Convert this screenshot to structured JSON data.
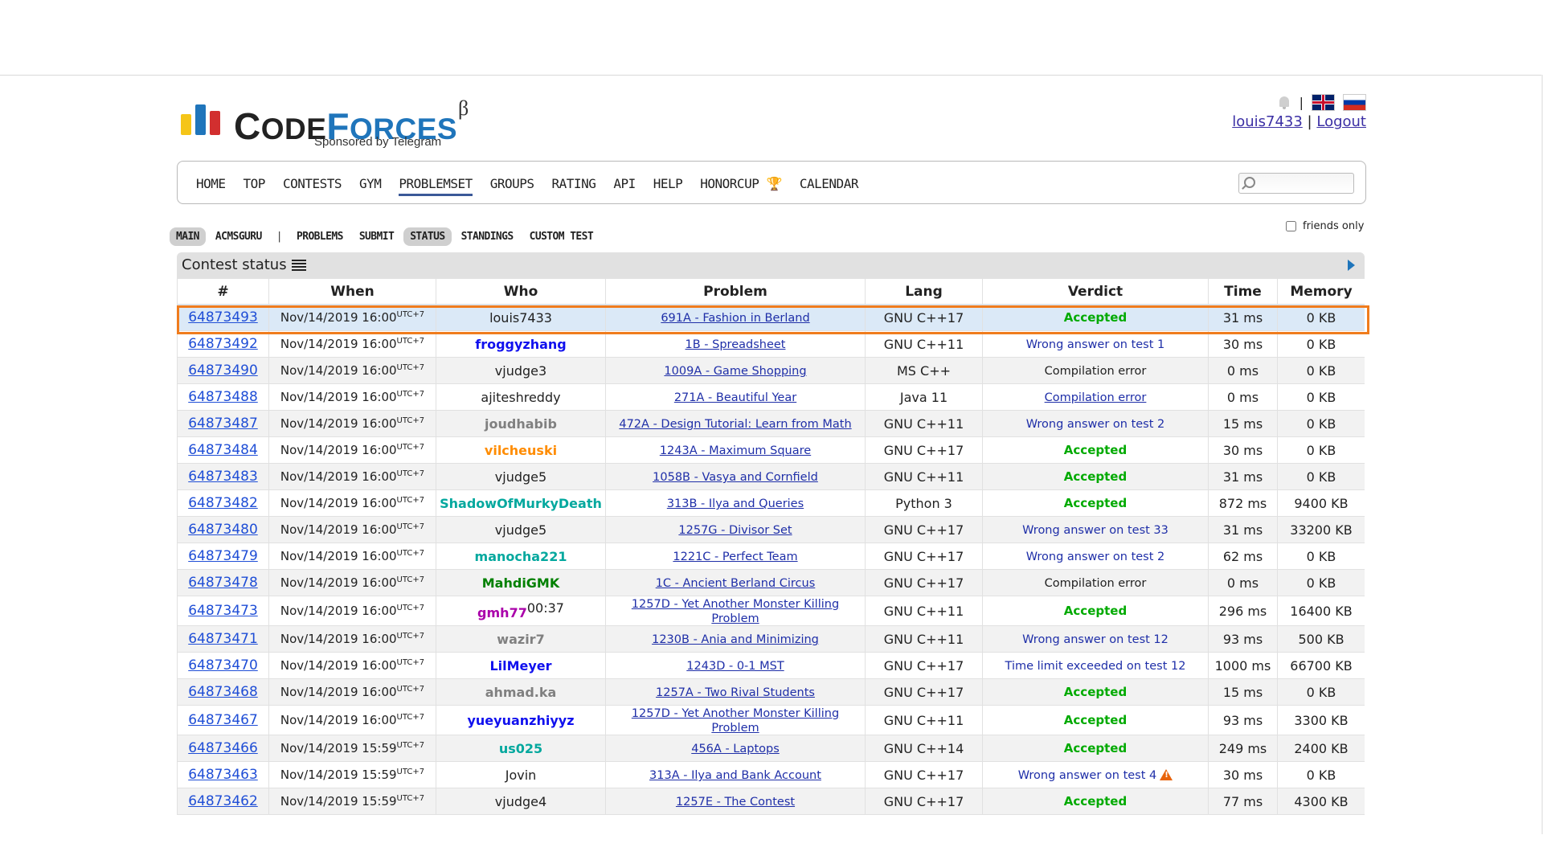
{
  "logo": {
    "c1": "C",
    "w1": "ODE",
    "c2": "F",
    "w2": "ORCES",
    "beta": "β",
    "sponsor": "Sponsored by Telegram",
    "bar_colors": [
      "#f5c518",
      "#1f75bb",
      "#d22f2f"
    ]
  },
  "header": {
    "user": "louis7433",
    "sep": "|",
    "logout": "Logout",
    "lang_sep": "|"
  },
  "nav": {
    "items": [
      "HOME",
      "TOP",
      "CONTESTS",
      "GYM",
      "PROBLEMSET",
      "GROUPS",
      "RATING",
      "API",
      "HELP",
      "HONORCUP 🏆",
      "CALENDAR"
    ],
    "active": "PROBLEMSET"
  },
  "subnav": {
    "main": "MAIN",
    "acmsguru": "ACMSGURU",
    "sep": "|",
    "problems": "PROBLEMS",
    "submit": "SUBMIT",
    "status": "STATUS",
    "standings": "STANDINGS",
    "custom": "CUSTOM TEST"
  },
  "friends_only": "friends only",
  "panel": {
    "title": "Contest status"
  },
  "columns": [
    "#",
    "When",
    "Who",
    "Problem",
    "Lang",
    "Verdict",
    "Time",
    "Memory"
  ],
  "colors": {
    "accepted": "#00aa00",
    "link": "#1f2fa8",
    "highlight": "#f07c1d"
  },
  "rows": [
    {
      "id": "64873493",
      "when": "Nov/14/2019 16:00",
      "tz": "UTC+7",
      "who": "louis7433",
      "who_color": "#222222",
      "who_bold": false,
      "problem": "691A - Fashion in Berland",
      "lang": "GNU C++17",
      "verdict": "Accepted",
      "vclass": "acc",
      "time": "31 ms",
      "memory": "0 KB"
    },
    {
      "id": "64873492",
      "when": "Nov/14/2019 16:00",
      "tz": "UTC+7",
      "who": "froggyzhang",
      "who_color": "#1010ee",
      "who_bold": true,
      "problem": "1B - Spreadsheet",
      "lang": "GNU C++11",
      "verdict": "Wrong answer on test 1",
      "vclass": "wa",
      "time": "30 ms",
      "memory": "0 KB"
    },
    {
      "id": "64873490",
      "when": "Nov/14/2019 16:00",
      "tz": "UTC+7",
      "who": "vjudge3",
      "who_color": "#222222",
      "who_bold": false,
      "problem": "1009A - Game Shopping",
      "lang": "MS C++",
      "verdict": "Compilation error",
      "vclass": "ce",
      "time": "0 ms",
      "memory": "0 KB"
    },
    {
      "id": "64873488",
      "when": "Nov/14/2019 16:00",
      "tz": "UTC+7",
      "who": "ajiteshreddy",
      "who_color": "#222222",
      "who_bold": false,
      "problem": "271A - Beautiful Year",
      "lang": "Java 11",
      "verdict": "Compilation error",
      "vclass": "cel",
      "time": "0 ms",
      "memory": "0 KB"
    },
    {
      "id": "64873487",
      "when": "Nov/14/2019 16:00",
      "tz": "UTC+7",
      "who": "joudhabib",
      "who_color": "#808080",
      "who_bold": true,
      "problem": "472A - Design Tutorial: Learn from Math",
      "lang": "GNU C++11",
      "verdict": "Wrong answer on test 2",
      "vclass": "wa",
      "time": "15 ms",
      "memory": "0 KB"
    },
    {
      "id": "64873484",
      "when": "Nov/14/2019 16:00",
      "tz": "UTC+7",
      "who": "vilcheuski",
      "who_color": "#ff8c00",
      "who_bold": true,
      "problem": "1243A - Maximum Square",
      "lang": "GNU C++17",
      "verdict": "Accepted",
      "vclass": "acc",
      "time": "30 ms",
      "memory": "0 KB"
    },
    {
      "id": "64873483",
      "when": "Nov/14/2019 16:00",
      "tz": "UTC+7",
      "who": "vjudge5",
      "who_color": "#222222",
      "who_bold": false,
      "problem": "1058B - Vasya and Cornfield",
      "lang": "GNU C++11",
      "verdict": "Accepted",
      "vclass": "acc",
      "time": "31 ms",
      "memory": "0 KB"
    },
    {
      "id": "64873482",
      "when": "Nov/14/2019 16:00",
      "tz": "UTC+7",
      "who": "ShadowOfMurkyDeath",
      "who_color": "#03a89e",
      "who_bold": true,
      "problem": "313B - Ilya and Queries",
      "lang": "Python 3",
      "verdict": "Accepted",
      "vclass": "acc",
      "time": "872 ms",
      "memory": "9400 KB"
    },
    {
      "id": "64873480",
      "when": "Nov/14/2019 16:00",
      "tz": "UTC+7",
      "who": "vjudge5",
      "who_color": "#222222",
      "who_bold": false,
      "problem": "1257G - Divisor Set",
      "lang": "GNU C++17",
      "verdict": "Wrong answer on test 33",
      "vclass": "wa",
      "time": "31 ms",
      "memory": "33200 KB"
    },
    {
      "id": "64873479",
      "when": "Nov/14/2019 16:00",
      "tz": "UTC+7",
      "who": "manocha221",
      "who_color": "#03a89e",
      "who_bold": true,
      "problem": "1221C - Perfect Team",
      "lang": "GNU C++17",
      "verdict": "Wrong answer on test 2",
      "vclass": "wa",
      "time": "62 ms",
      "memory": "0 KB"
    },
    {
      "id": "64873478",
      "when": "Nov/14/2019 16:00",
      "tz": "UTC+7",
      "who": "MahdiGMK",
      "who_color": "#008000",
      "who_bold": true,
      "problem": "1C - Ancient Berland Circus",
      "lang": "GNU C++17",
      "verdict": "Compilation error",
      "vclass": "ce",
      "time": "0 ms",
      "memory": "0 KB"
    },
    {
      "id": "64873473",
      "when": "Nov/14/2019 16:00",
      "tz": "UTC+7",
      "who": "gmh77",
      "who_color": "#aa00aa",
      "who_bold": true,
      "who_sup": "00:37",
      "problem": "1257D - Yet Another Monster Killing Problem",
      "lang": "GNU C++11",
      "verdict": "Accepted",
      "vclass": "acc",
      "time": "296 ms",
      "memory": "16400 KB",
      "tall": true
    },
    {
      "id": "64873471",
      "when": "Nov/14/2019 16:00",
      "tz": "UTC+7",
      "who": "wazir7",
      "who_color": "#808080",
      "who_bold": true,
      "problem": "1230B - Ania and Minimizing",
      "lang": "GNU C++11",
      "verdict": "Wrong answer on test 12",
      "vclass": "wa",
      "time": "93 ms",
      "memory": "500 KB"
    },
    {
      "id": "64873470",
      "when": "Nov/14/2019 16:00",
      "tz": "UTC+7",
      "who": "LilMeyer",
      "who_color": "#1010ee",
      "who_bold": true,
      "problem": "1243D - 0-1 MST",
      "lang": "GNU C++17",
      "verdict": "Time limit exceeded on test 12",
      "vclass": "wa",
      "time": "1000 ms",
      "memory": "66700 KB"
    },
    {
      "id": "64873468",
      "when": "Nov/14/2019 16:00",
      "tz": "UTC+7",
      "who": "ahmad.ka",
      "who_color": "#808080",
      "who_bold": true,
      "problem": "1257A - Two Rival Students",
      "lang": "GNU C++17",
      "verdict": "Accepted",
      "vclass": "acc",
      "time": "15 ms",
      "memory": "0 KB"
    },
    {
      "id": "64873467",
      "when": "Nov/14/2019 16:00",
      "tz": "UTC+7",
      "who": "yueyuanzhiyyz",
      "who_color": "#1010ee",
      "who_bold": true,
      "problem": "1257D - Yet Another Monster Killing Problem",
      "lang": "GNU C++11",
      "verdict": "Accepted",
      "vclass": "acc",
      "time": "93 ms",
      "memory": "3300 KB",
      "tall": true
    },
    {
      "id": "64873466",
      "when": "Nov/14/2019 15:59",
      "tz": "UTC+7",
      "who": "us025",
      "who_color": "#03a89e",
      "who_bold": true,
      "problem": "456A - Laptops",
      "lang": "GNU C++14",
      "verdict": "Accepted",
      "vclass": "acc",
      "time": "249 ms",
      "memory": "2400 KB"
    },
    {
      "id": "64873463",
      "when": "Nov/14/2019 15:59",
      "tz": "UTC+7",
      "who": "Jovin",
      "who_color": "#222222",
      "who_bold": false,
      "problem": "313A - Ilya and Bank Account",
      "lang": "GNU C++17",
      "verdict": "Wrong answer on test 4",
      "vclass": "wa",
      "warn": true,
      "time": "30 ms",
      "memory": "0 KB"
    },
    {
      "id": "64873462",
      "when": "Nov/14/2019 15:59",
      "tz": "UTC+7",
      "who": "vjudge4",
      "who_color": "#222222",
      "who_bold": false,
      "problem": "1257E - The Contest",
      "lang": "GNU C++17",
      "verdict": "Accepted",
      "vclass": "acc",
      "time": "77 ms",
      "memory": "4300 KB"
    }
  ]
}
